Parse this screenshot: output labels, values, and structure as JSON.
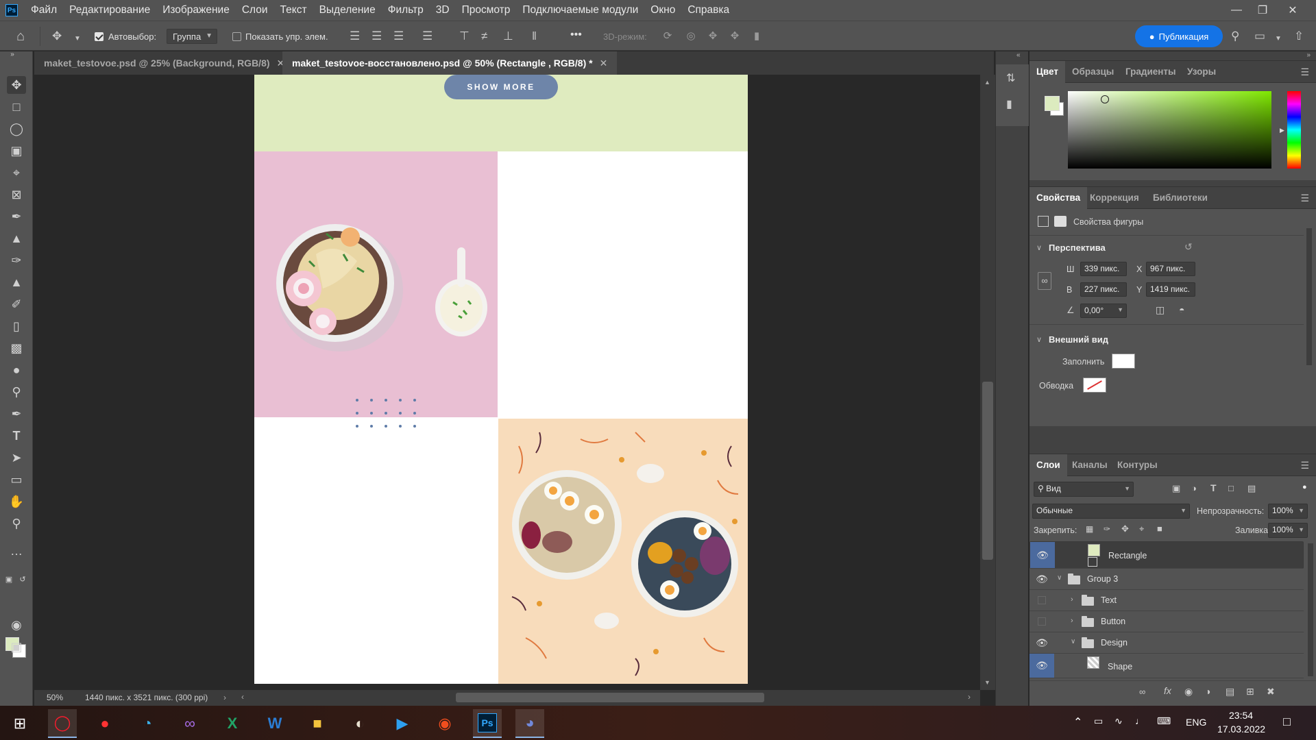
{
  "menubar": {
    "logo": "Ps",
    "items": [
      "Файл",
      "Редактирование",
      "Изображение",
      "Слои",
      "Текст",
      "Выделение",
      "Фильтр",
      "3D",
      "Просмотр",
      "Подключаемые модули",
      "Окно",
      "Справка"
    ]
  },
  "options": {
    "autoselect_label": "Автовыбор:",
    "autoselect_value": "Группа",
    "show_transform_label": "Показать упр. элем.",
    "mode_3d_label": "3D-режим:",
    "more": "•••",
    "publish_label": "Публикация"
  },
  "tabs": [
    {
      "label": "maket_testovoe.psd @ 25% (Background, RGB/8)",
      "active": false
    },
    {
      "label": "maket_testovoe-восстановлено.psd @ 50% (Rectangle , RGB/8) *",
      "active": true
    }
  ],
  "canvas": {
    "button_label": "SHOW MORE",
    "colors": {
      "band": "#dfebbf",
      "pink": "#e9bfd3",
      "peach": "#f8dcbb",
      "button": "#6e85a9",
      "dots": "#5f7ca8"
    }
  },
  "status": {
    "zoom": "50%",
    "doc_info": "1440 пикс. x 3521 пикс. (300 ppi)"
  },
  "color_panel": {
    "tabs": [
      "Цвет",
      "Образцы",
      "Градиенты",
      "Узоры"
    ],
    "fg_color": "#dcebbf",
    "bg_color": "#ffffff"
  },
  "properties_panel": {
    "tabs": [
      "Свойства",
      "Коррекция",
      "Библиотеки"
    ],
    "shape_props": "Свойства фигуры",
    "transform_title": "Перспектива",
    "w_label": "Ш",
    "w_value": "339 пикс.",
    "h_label": "В",
    "h_value": "227 пикс.",
    "x_label": "X",
    "x_value": "967 пикс.",
    "y_label": "Y",
    "y_value": "1419 пикс.",
    "angle_value": "0,00°",
    "appearance_title": "Внешний вид",
    "fill_label": "Заполнить",
    "stroke_label": "Обводка"
  },
  "layers_panel": {
    "tabs": [
      "Слои",
      "Каналы",
      "Контуры"
    ],
    "filter_label": "Вид",
    "blend_mode": "Обычные",
    "opacity_label": "Непрозрачность:",
    "opacity_value": "100%",
    "lock_label": "Закрепить:",
    "fill_label": "Заливка:",
    "fill_value": "100%",
    "layers": [
      {
        "name": "Rectangle",
        "visible": true
      },
      {
        "name": "Group 3",
        "visible": true
      },
      {
        "name": "Text",
        "visible": false
      },
      {
        "name": "Button",
        "visible": false
      },
      {
        "name": "Design",
        "visible": true
      },
      {
        "name": "Shape",
        "visible": true
      }
    ]
  },
  "taskbar": {
    "lang": "ENG",
    "time": "23:54",
    "date": "17.03.2022",
    "apps": [
      "windows",
      "opera",
      "yandex",
      "edge",
      "visual-studio",
      "excel",
      "word",
      "file-explorer",
      "paint",
      "vscode",
      "figma",
      "photoshop",
      "discord"
    ]
  }
}
